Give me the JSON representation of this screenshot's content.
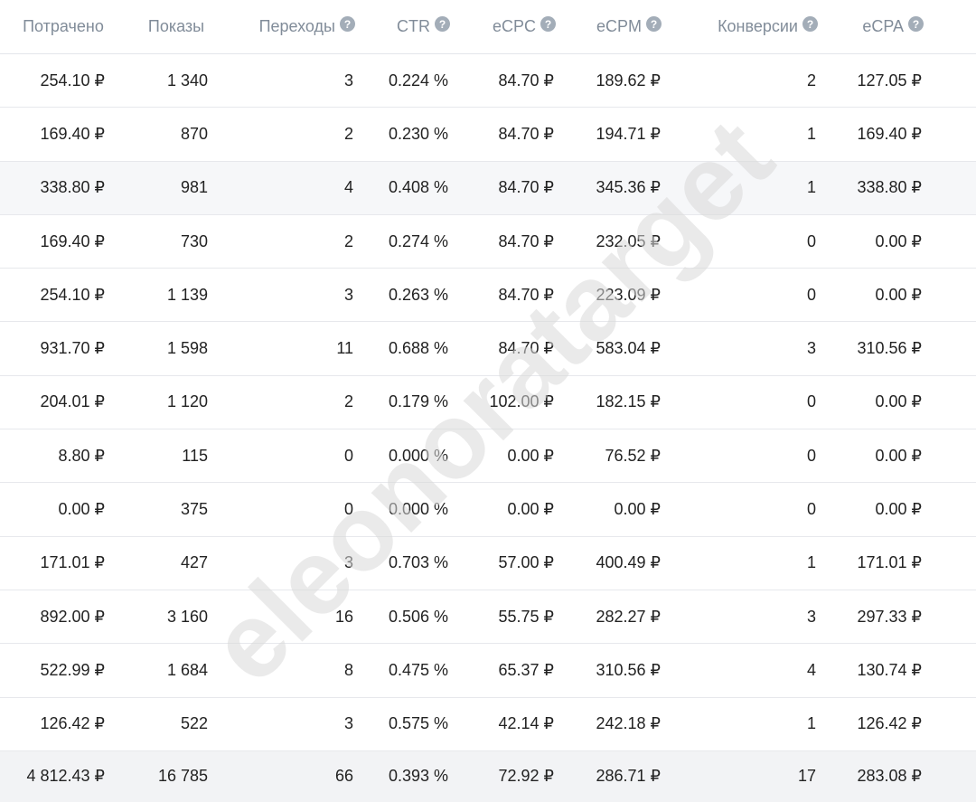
{
  "header": {
    "spent": "Потрачено",
    "impressions": "Показы",
    "clicks": "Переходы",
    "ctr": "CTR",
    "ecpc": "eCPC",
    "ecpm": "eCPM",
    "conversions": "Конверсии",
    "ecpa": "eCPA",
    "help_glyph": "?"
  },
  "rows": [
    {
      "spent": "254.10 ₽",
      "impressions": "1 340",
      "clicks": "3",
      "ctr": "0.224 %",
      "ecpc": "84.70 ₽",
      "ecpm": "189.62 ₽",
      "conversions": "2",
      "ecpa": "127.05 ₽"
    },
    {
      "spent": "169.40 ₽",
      "impressions": "870",
      "clicks": "2",
      "ctr": "0.230 %",
      "ecpc": "84.70 ₽",
      "ecpm": "194.71 ₽",
      "conversions": "1",
      "ecpa": "169.40 ₽"
    },
    {
      "spent": "338.80 ₽",
      "impressions": "981",
      "clicks": "4",
      "ctr": "0.408 %",
      "ecpc": "84.70 ₽",
      "ecpm": "345.36 ₽",
      "conversions": "1",
      "ecpa": "338.80 ₽"
    },
    {
      "spent": "169.40 ₽",
      "impressions": "730",
      "clicks": "2",
      "ctr": "0.274 %",
      "ecpc": "84.70 ₽",
      "ecpm": "232.05 ₽",
      "conversions": "0",
      "ecpa": "0.00 ₽"
    },
    {
      "spent": "254.10 ₽",
      "impressions": "1 139",
      "clicks": "3",
      "ctr": "0.263 %",
      "ecpc": "84.70 ₽",
      "ecpm": "223.09 ₽",
      "conversions": "0",
      "ecpa": "0.00 ₽"
    },
    {
      "spent": "931.70 ₽",
      "impressions": "1 598",
      "clicks": "11",
      "ctr": "0.688 %",
      "ecpc": "84.70 ₽",
      "ecpm": "583.04 ₽",
      "conversions": "3",
      "ecpa": "310.56 ₽"
    },
    {
      "spent": "204.01 ₽",
      "impressions": "1 120",
      "clicks": "2",
      "ctr": "0.179 %",
      "ecpc": "102.00 ₽",
      "ecpm": "182.15 ₽",
      "conversions": "0",
      "ecpa": "0.00 ₽"
    },
    {
      "spent": "8.80 ₽",
      "impressions": "115",
      "clicks": "0",
      "ctr": "0.000 %",
      "ecpc": "0.00 ₽",
      "ecpm": "76.52 ₽",
      "conversions": "0",
      "ecpa": "0.00 ₽"
    },
    {
      "spent": "0.00 ₽",
      "impressions": "375",
      "clicks": "0",
      "ctr": "0.000 %",
      "ecpc": "0.00 ₽",
      "ecpm": "0.00 ₽",
      "conversions": "0",
      "ecpa": "0.00 ₽"
    },
    {
      "spent": "171.01 ₽",
      "impressions": "427",
      "clicks": "3",
      "ctr": "0.703 %",
      "ecpc": "57.00 ₽",
      "ecpm": "400.49 ₽",
      "conversions": "1",
      "ecpa": "171.01 ₽"
    },
    {
      "spent": "892.00 ₽",
      "impressions": "3 160",
      "clicks": "16",
      "ctr": "0.506 %",
      "ecpc": "55.75 ₽",
      "ecpm": "282.27 ₽",
      "conversions": "3",
      "ecpa": "297.33 ₽"
    },
    {
      "spent": "522.99 ₽",
      "impressions": "1 684",
      "clicks": "8",
      "ctr": "0.475 %",
      "ecpc": "65.37 ₽",
      "ecpm": "310.56 ₽",
      "conversions": "4",
      "ecpa": "130.74 ₽"
    },
    {
      "spent": "126.42 ₽",
      "impressions": "522",
      "clicks": "3",
      "ctr": "0.575 %",
      "ecpc": "42.14 ₽",
      "ecpm": "242.18 ₽",
      "conversions": "1",
      "ecpa": "126.42 ₽"
    }
  ],
  "total": {
    "spent": "4 812.43 ₽",
    "impressions": "16 785",
    "clicks": "66",
    "ctr": "0.393 %",
    "ecpc": "72.92 ₽",
    "ecpm": "286.71 ₽",
    "conversions": "17",
    "ecpa": "283.08 ₽"
  },
  "watermark": {
    "text": "eleonoratarget"
  },
  "colors": {
    "header_text": "#818c99",
    "help_icon": "#a3adb8",
    "row_highlight": "#f6f7f9",
    "total_bg": "#f2f3f5",
    "watermark": "#d9d9d9"
  }
}
